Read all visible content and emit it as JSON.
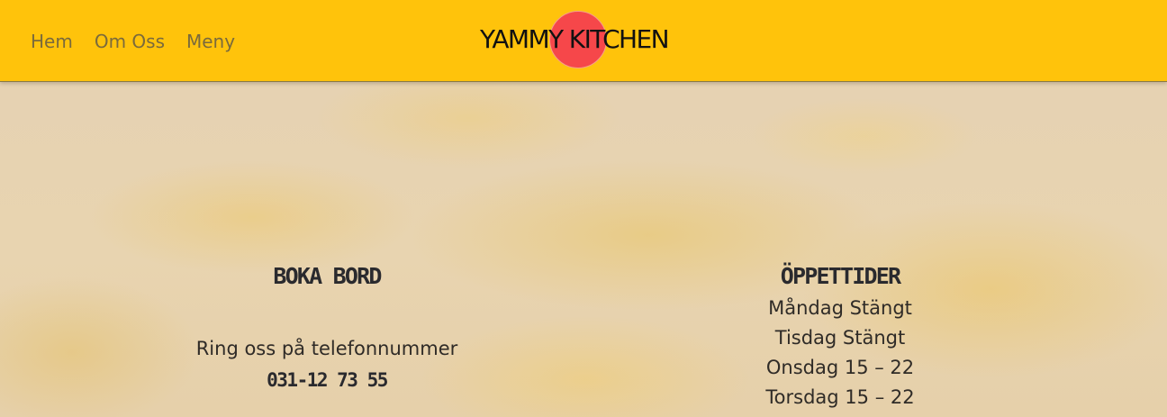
{
  "header": {
    "nav": [
      {
        "label": "Hem"
      },
      {
        "label": "Om Oss"
      },
      {
        "label": "Meny"
      }
    ],
    "logo_text": "YAMMY KITCHEN",
    "background_color": "#ffc30b",
    "logo_circle_color": "#f6474a"
  },
  "booking": {
    "heading": "BOKA BORD",
    "text": "Ring oss på telefonnummer",
    "phone": "031-12 73 55"
  },
  "hours": {
    "heading": "ÖPPETTIDER",
    "days": [
      "Måndag Stängt",
      "Tisdag Stängt",
      "Onsdag 15 – 22",
      "Torsdag 15 – 22"
    ]
  }
}
